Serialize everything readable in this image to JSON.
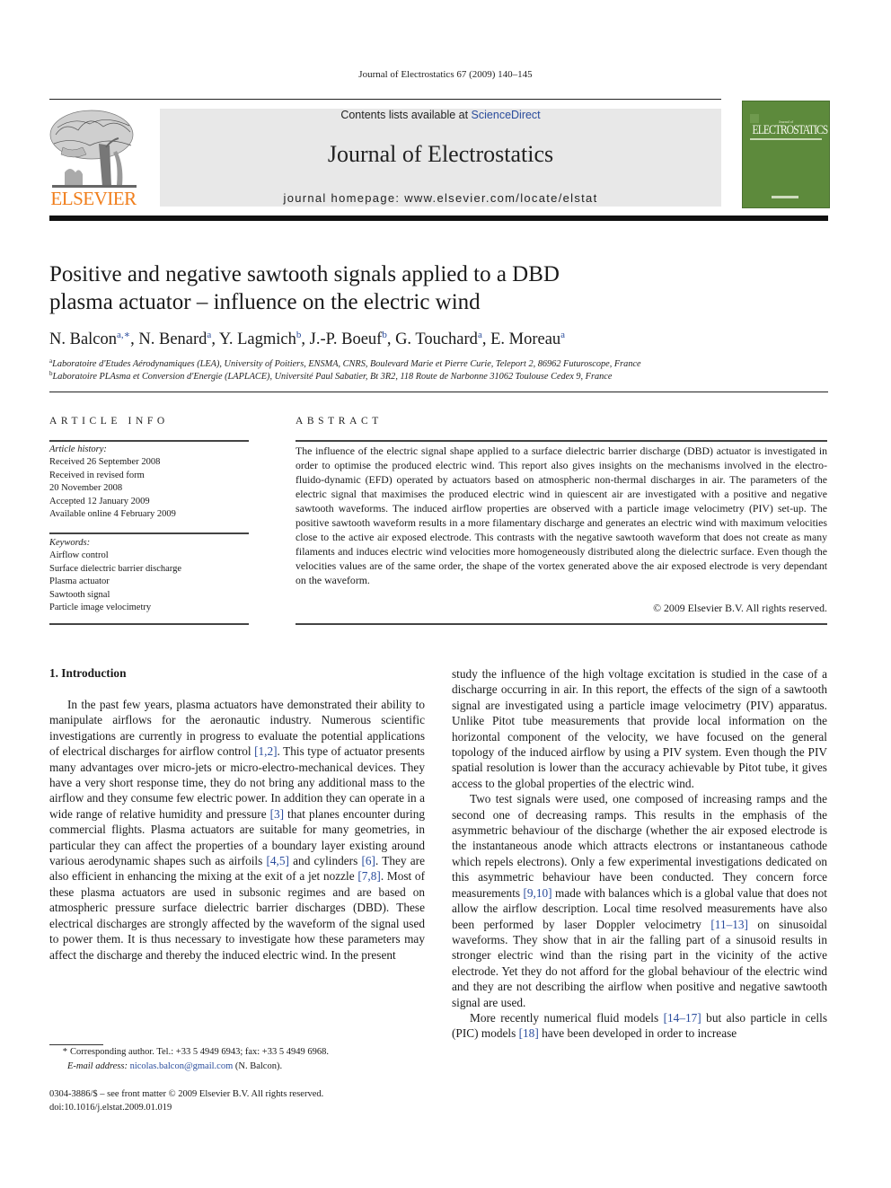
{
  "header": {
    "citation": "Journal of Electrostatics 67 (2009) 140–145",
    "contents_prefix": "Contents lists available at ",
    "contents_link": "ScienceDirect",
    "journal_title": "Journal of Electrostatics",
    "homepage": "journal homepage: www.elsevier.com/locate/elstat",
    "publisher_logo_text": "ELSEVIER",
    "cover": {
      "journal_of": "Journal of",
      "name": "ELECTROSTATICS",
      "color": "#5d8a3c"
    }
  },
  "article": {
    "title_line1": "Positive and negative sawtooth signals applied to a DBD",
    "title_line2": "plasma actuator – influence on the electric wind",
    "authors": [
      {
        "name": "N. Balcon",
        "aff": "a,∗"
      },
      {
        "name": "N. Benard",
        "aff": "a"
      },
      {
        "name": "Y. Lagmich",
        "aff": "b"
      },
      {
        "name": "J.-P. Boeuf",
        "aff": "b"
      },
      {
        "name": "G. Touchard",
        "aff": "a"
      },
      {
        "name": "E. Moreau",
        "aff": "a"
      }
    ],
    "affiliations": [
      {
        "mark": "a",
        "text": "Laboratoire d'Etudes Aérodynamiques (LEA), University of Poitiers, ENSMA, CNRS, Boulevard Marie et Pierre Curie, Teleport 2, 86962 Futuroscope, France"
      },
      {
        "mark": "b",
        "text": "Laboratoire PLAsma et Conversion d'Energie (LAPLACE), Université Paul Sabatier, Bt 3R2, 118 Route de Narbonne 31062 Toulouse Cedex 9, France"
      }
    ]
  },
  "article_info": {
    "heading": "ARTICLE INFO",
    "history_label": "Article history:",
    "history": [
      "Received 26 September 2008",
      "Received in revised form",
      "20 November 2008",
      "Accepted 12 January 2009",
      "Available online 4 February 2009"
    ],
    "keywords_label": "Keywords:",
    "keywords": [
      "Airflow control",
      "Surface dielectric barrier discharge",
      "Plasma actuator",
      "Sawtooth signal",
      "Particle image velocimetry"
    ]
  },
  "abstract": {
    "heading": "ABSTRACT",
    "text": "The influence of the electric signal shape applied to a surface dielectric barrier discharge (DBD) actuator is investigated in order to optimise the produced electric wind. This report also gives insights on the mechanisms involved in the electro-fluido-dynamic (EFD) operated by actuators based on atmospheric non-thermal discharges in air. The parameters of the electric signal that maximises the produced electric wind in quiescent air are investigated with a positive and negative sawtooth waveforms. The induced airflow properties are observed with a particle image velocimetry (PIV) set-up. The positive sawtooth waveform results in a more filamentary discharge and generates an electric wind with maximum velocities close to the active air exposed electrode. This contrasts with the negative sawtooth waveform that does not create as many filaments and induces electric wind velocities more homogeneously distributed along the dielectric surface. Even though the velocities values are of the same order, the shape of the vortex generated above the air exposed electrode is very dependant on the waveform.",
    "copyright": "© 2009 Elsevier B.V. All rights reserved."
  },
  "introduction": {
    "heading": "1.  Introduction",
    "left_p1": [
      {
        "t": "In the past few years, plasma actuators have demonstrated their ability to manipulate airflows for the aeronautic industry. Numerous scientific investigations are currently in progress to evaluate the potential applications of electrical discharges for airflow control "
      },
      {
        "r": "[1,2]"
      },
      {
        "t": ". This type of actuator presents many advantages over micro-jets or micro-electro-mechanical devices. They have a very short response time, they do not bring any additional mass to the airflow and they consume few electric power. In addition they can operate in a wide range of relative humidity and pressure "
      },
      {
        "r": "[3]"
      },
      {
        "t": " that planes encounter during commercial flights. Plasma actuators are suitable for many geometries, in particular they can affect the properties of a boundary layer existing around various aerodynamic shapes such as airfoils "
      },
      {
        "r": "[4,5]"
      },
      {
        "t": " and cylinders "
      },
      {
        "r": "[6]"
      },
      {
        "t": ". They are also efficient in enhancing the mixing at the exit of a jet nozzle "
      },
      {
        "r": "[7,8]"
      },
      {
        "t": ". Most of these plasma actuators are used in subsonic regimes and are based on atmospheric pressure surface dielectric barrier discharges (DBD). These electrical discharges are strongly affected by the waveform of the signal used to power them. It is thus necessary to investigate how these parameters may affect the discharge and thereby the induced electric wind. In the present"
      }
    ],
    "right_p1": [
      {
        "t": "study the influence of the high voltage excitation is studied in the case of a discharge occurring in air. In this report, the effects of the sign of a sawtooth signal are investigated using a particle image velocimetry (PIV) apparatus. Unlike Pitot tube measurements that provide local information on the horizontal component of the velocity, we have focused on the general topology of the induced airflow by using a PIV system. Even though the PIV spatial resolution is lower than the accuracy achievable by Pitot tube, it gives access to the global properties of the electric wind."
      }
    ],
    "right_p2": [
      {
        "t": "Two test signals were used, one composed of increasing ramps and the second one of decreasing ramps. This results in the emphasis of the asymmetric behaviour of the discharge (whether the air exposed electrode is the instantaneous anode which attracts electrons or instantaneous cathode which repels electrons). Only a few experimental investigations dedicated on this asymmetric behaviour have been conducted. They concern force measurements "
      },
      {
        "r": "[9,10]"
      },
      {
        "t": " made with balances which is a global value that does not allow the airflow description. Local time resolved measurements have also been performed by laser Doppler velocimetry "
      },
      {
        "r": "[11–13]"
      },
      {
        "t": " on sinusoidal waveforms. They show that in air the falling part of a sinusoid results in stronger electric wind than the rising part in the vicinity of the active electrode. Yet they do not afford for the global behaviour of the electric wind and they are not describing the airflow when positive and negative sawtooth signal are used."
      }
    ],
    "right_p3": [
      {
        "t": "More recently numerical fluid models "
      },
      {
        "r": "[14–17]"
      },
      {
        "t": " but also particle in cells (PIC) models "
      },
      {
        "r": "[18]"
      },
      {
        "t": " have been developed in order to increase"
      }
    ]
  },
  "footnotes": {
    "star": "*",
    "corresponding": "Corresponding author. Tel.: +33 5 4949 6943; fax: +33 5 4949 6968.",
    "email_label": "E-mail address: ",
    "email": "nicolas.balcon@gmail.com",
    "email_suffix": " (N. Balcon).",
    "front_matter": "0304-3886/$ – see front matter © 2009 Elsevier B.V. All rights reserved.",
    "doi": "doi:10.1016/j.elstat.2009.01.019"
  }
}
